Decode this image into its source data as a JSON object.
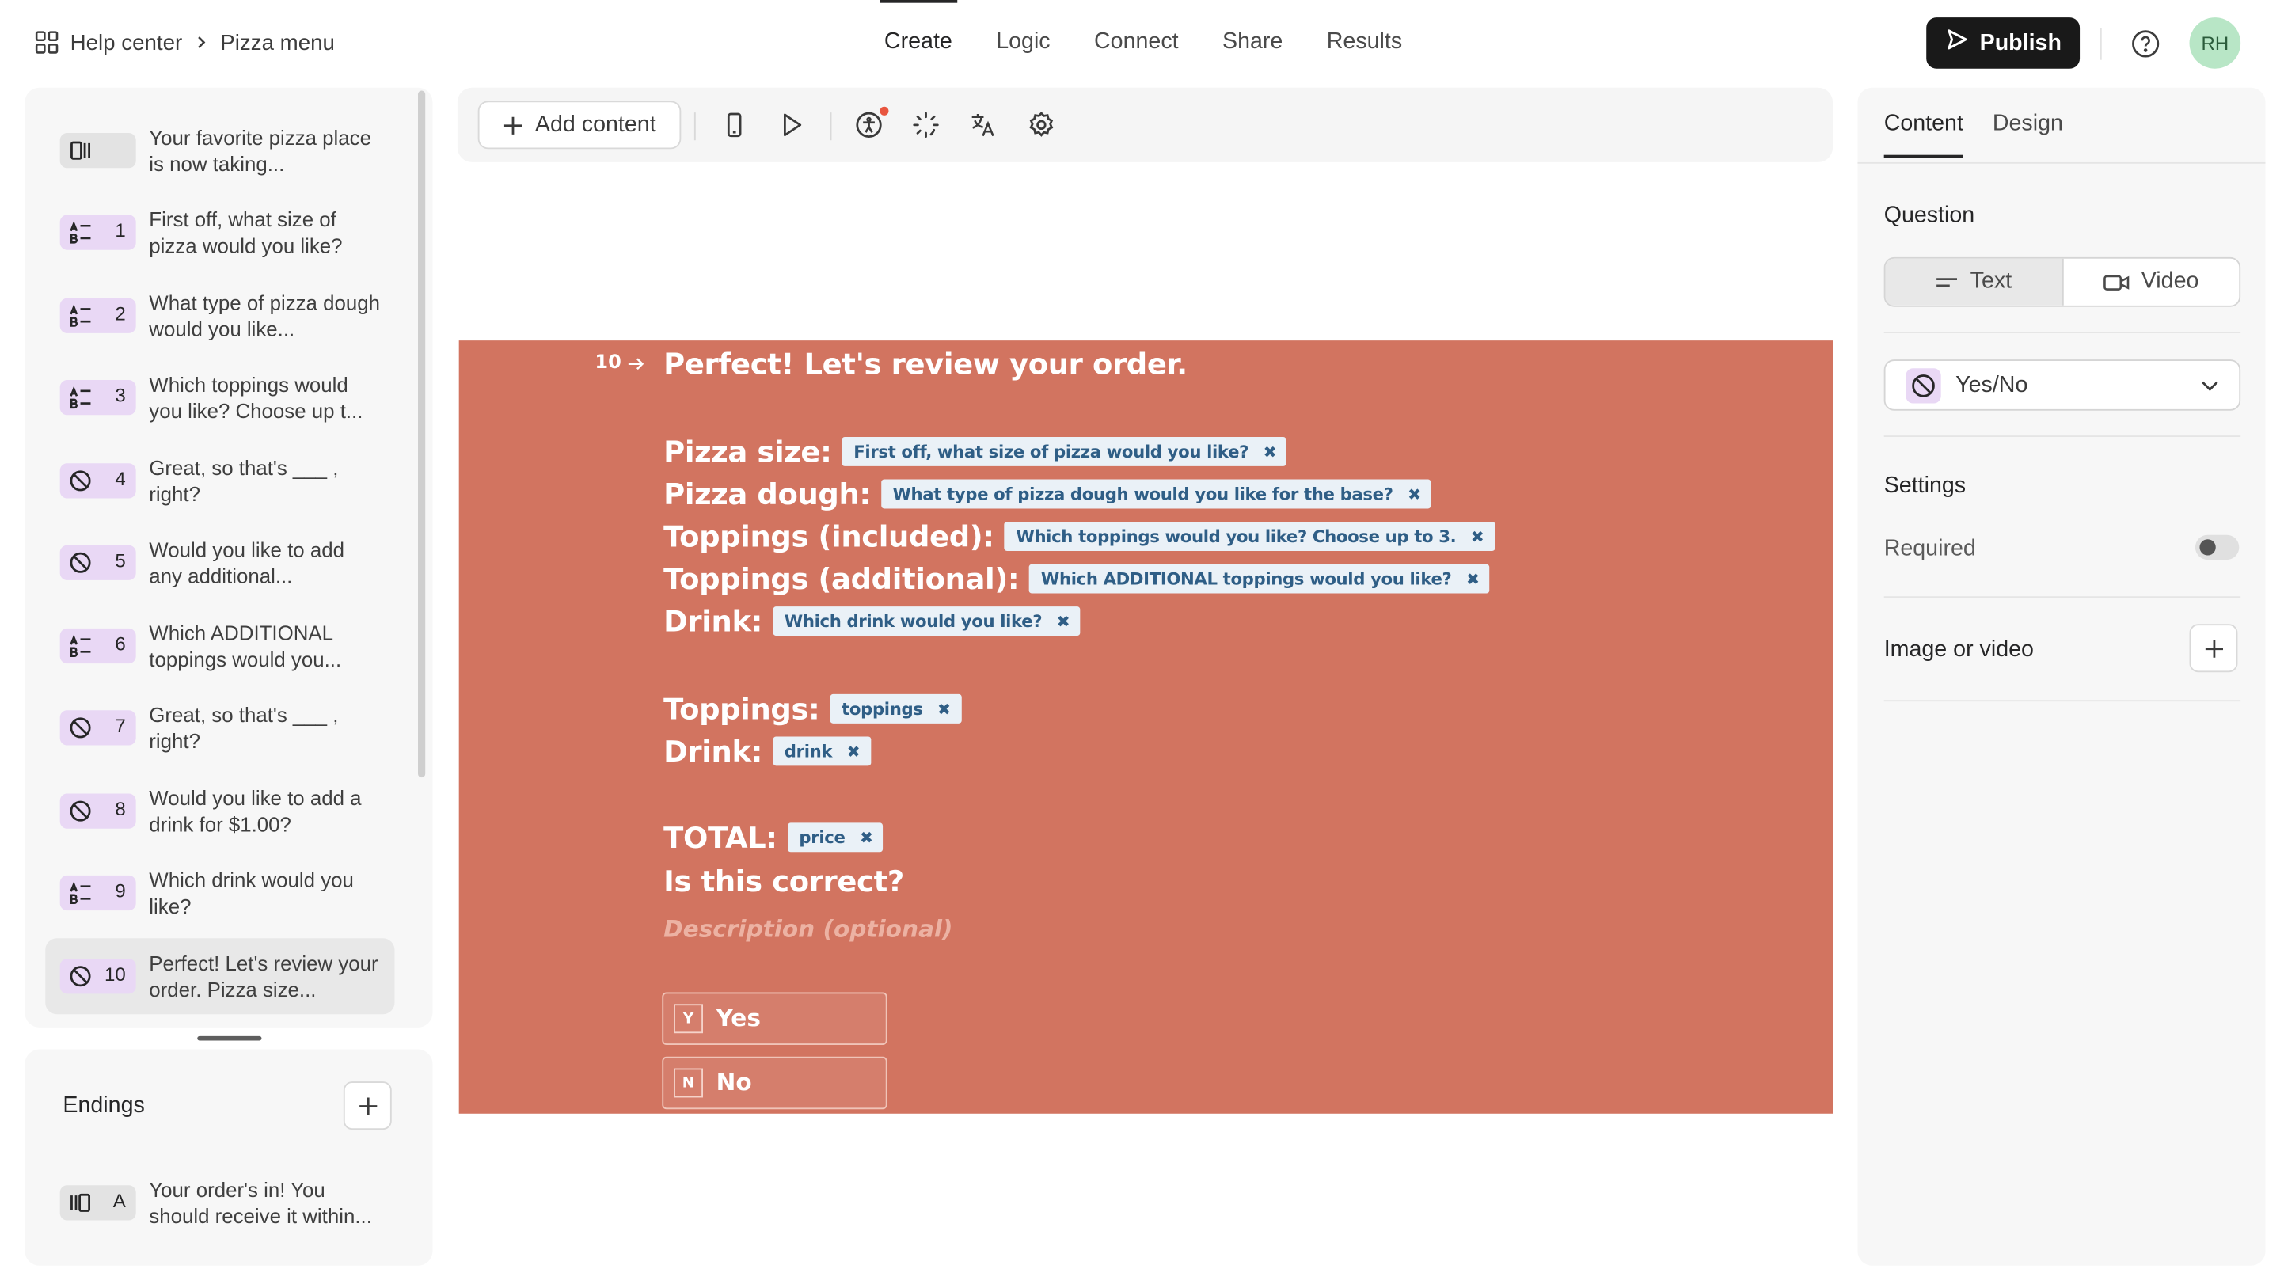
{
  "breadcrumb": {
    "home": "Help center",
    "current": "Pizza menu"
  },
  "topnav": {
    "tabs": [
      "Create",
      "Logic",
      "Connect",
      "Share",
      "Results"
    ],
    "active": "Create"
  },
  "header": {
    "publish_label": "Publish",
    "avatar_initials": "RH"
  },
  "sidebar": {
    "items": [
      {
        "num": "",
        "icon": "welcome-screen-icon",
        "text": "Your favorite pizza place is now taking..."
      },
      {
        "num": "1",
        "icon": "multiple-choice-icon",
        "text": "First off, what size of pizza would you like?"
      },
      {
        "num": "2",
        "icon": "multiple-choice-icon",
        "text": "What type of pizza dough would you like..."
      },
      {
        "num": "3",
        "icon": "multiple-choice-icon",
        "text": "Which toppings would you like? Choose up t..."
      },
      {
        "num": "4",
        "icon": "yes-no-icon",
        "text": "Great, so that's ___ , right?"
      },
      {
        "num": "5",
        "icon": "yes-no-icon",
        "text": "Would you like to add any additional..."
      },
      {
        "num": "6",
        "icon": "multiple-choice-icon",
        "text": "Which ADDITIONAL toppings would you..."
      },
      {
        "num": "7",
        "icon": "yes-no-icon",
        "text": "Great, so that's ___ , right?"
      },
      {
        "num": "8",
        "icon": "yes-no-icon",
        "text": "Would you like to add a drink for $1.00?"
      },
      {
        "num": "9",
        "icon": "multiple-choice-icon",
        "text": "Which drink would you like?"
      },
      {
        "num": "10",
        "icon": "yes-no-icon",
        "text": "Perfect! Let's review your order. Pizza size..."
      }
    ],
    "active_index": 10
  },
  "endings": {
    "title": "Endings",
    "items": [
      {
        "num": "A",
        "icon": "ending-screen-icon",
        "text": "Your order's in! You should receive it within..."
      }
    ]
  },
  "toolbar": {
    "add_content_label": "Add content"
  },
  "canvas": {
    "question_number": "10",
    "title": "Perfect! Let's review your order.",
    "recall_lines": [
      {
        "label": "Pizza size:",
        "chip": "First off, what size of pizza would you like?"
      },
      {
        "label": "Pizza dough:",
        "chip": "What type of pizza dough would you like for the base?"
      },
      {
        "label": "Toppings (included):",
        "chip": "Which toppings would you like? Choose up to 3."
      },
      {
        "label": "Toppings (additional):",
        "chip": "Which ADDITIONAL toppings would you like?"
      },
      {
        "label": "Drink:",
        "chip": "Which drink would you like?"
      }
    ],
    "variable_lines": [
      {
        "label": "Toppings:",
        "chip": "toppings"
      },
      {
        "label": "Drink:",
        "chip": "drink"
      }
    ],
    "total_line": {
      "label": "TOTAL:",
      "chip": "price"
    },
    "question_text": "Is this correct?",
    "description_placeholder": "Description (optional)",
    "choices": [
      {
        "key": "Y",
        "label": "Yes"
      },
      {
        "key": "N",
        "label": "No"
      }
    ],
    "chip_remove_glyph": "✖",
    "background_color": "#d27460"
  },
  "right_panel": {
    "tabs": [
      "Content",
      "Design"
    ],
    "active_tab": "Content",
    "question_heading": "Question",
    "question_type_options": [
      "Text",
      "Video"
    ],
    "selected_question_type": "Text",
    "answer_type": "Yes/No",
    "settings_heading": "Settings",
    "required_label": "Required",
    "required_enabled": false,
    "image_or_video_label": "Image or video"
  }
}
